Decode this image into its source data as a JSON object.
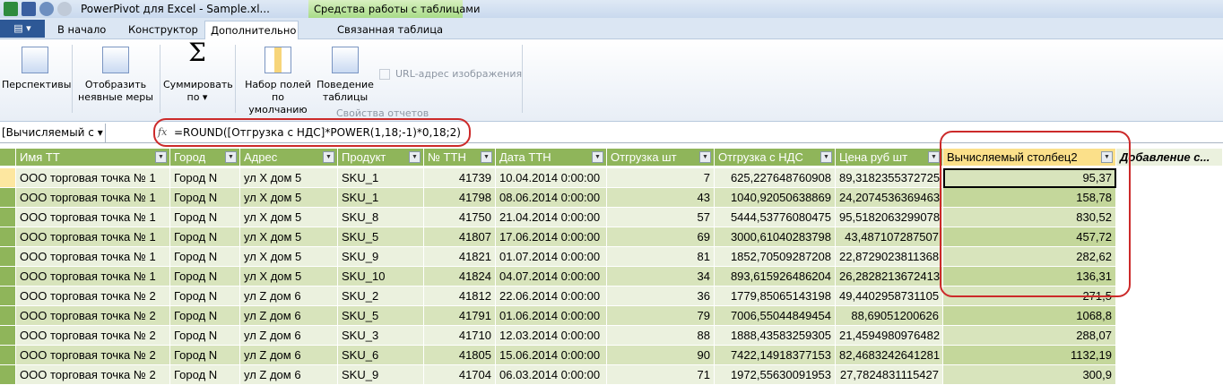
{
  "window": {
    "title": "PowerPivot для Excel - Sample.xl...",
    "context_tab": "Средства работы с таблицами"
  },
  "tabs": [
    "В начало",
    "Конструктор",
    "Дополнительно",
    "Связанная таблица"
  ],
  "ribbon": {
    "perspectives": "Перспективы",
    "show_implicit_1": "Отобразить",
    "show_implicit_2": "неявные меры",
    "summarize_1": "Суммировать",
    "summarize_2": "по ▾",
    "default_fields_1": "Набор полей",
    "default_fields_2": "по умолчанию",
    "table_behavior_1": "Поведение",
    "table_behavior_2": "таблицы",
    "image_url": "URL-адрес изображения",
    "group_label": "Свойства отчетов"
  },
  "formula_bar": {
    "name_box": "[Вычисляемый с",
    "formula": "=ROUND([Отгрузка с НДС]*POWER(1,18;-1)*0,18;2)"
  },
  "colors": {
    "header_green": "#8fb55a",
    "highlight_red": "#cc2a2a",
    "calc_header": "#fbe08a"
  },
  "table": {
    "columns": [
      "Имя ТТ",
      "Город",
      "Адрес",
      "Продукт",
      "№ ТТН",
      "Дата ТТН",
      "Отгрузка  шт",
      "Отгрузка с НДС",
      "Цена руб шт",
      "Вычисляемый столбец2",
      "Добавление с..."
    ],
    "rows": [
      [
        "ООО торговая точка № 1",
        "Город N",
        "ул X дом 5",
        "SKU_1",
        "41739",
        "10.04.2014 0:00:00",
        "7",
        "625,227648760908",
        "89,3182355372725",
        "95,37"
      ],
      [
        "ООО торговая точка № 1",
        "Город N",
        "ул X дом 5",
        "SKU_1",
        "41798",
        "08.06.2014 0:00:00",
        "43",
        "1040,92050638869",
        "24,2074536369463",
        "158,78"
      ],
      [
        "ООО торговая точка № 1",
        "Город N",
        "ул X дом 5",
        "SKU_8",
        "41750",
        "21.04.2014 0:00:00",
        "57",
        "5444,53776080475",
        "95,5182063299078",
        "830,52"
      ],
      [
        "ООО торговая точка № 1",
        "Город N",
        "ул X дом 5",
        "SKU_5",
        "41807",
        "17.06.2014 0:00:00",
        "69",
        "3000,61040283798",
        "43,487107287507",
        "457,72"
      ],
      [
        "ООО торговая точка № 1",
        "Город N",
        "ул X дом 5",
        "SKU_9",
        "41821",
        "01.07.2014 0:00:00",
        "81",
        "1852,70509287208",
        "22,8729023811368",
        "282,62"
      ],
      [
        "ООО торговая точка № 1",
        "Город N",
        "ул X дом 5",
        "SKU_10",
        "41824",
        "04.07.2014 0:00:00",
        "34",
        "893,615926486204",
        "26,2828213672413",
        "136,31"
      ],
      [
        "ООО торговая точка № 2",
        "Город N",
        "ул Z дом 6",
        "SKU_2",
        "41812",
        "22.06.2014 0:00:00",
        "36",
        "1779,85065143198",
        "49,4402958731105",
        "271,5"
      ],
      [
        "ООО торговая точка № 2",
        "Город N",
        "ул Z дом 6",
        "SKU_5",
        "41791",
        "01.06.2014 0:00:00",
        "79",
        "7006,55044849454",
        "88,69051200626",
        "1068,8"
      ],
      [
        "ООО торговая точка № 2",
        "Город N",
        "ул Z дом 6",
        "SKU_3",
        "41710",
        "12.03.2014 0:00:00",
        "88",
        "1888,43583259305",
        "21,4594980976482",
        "288,07"
      ],
      [
        "ООО торговая точка № 2",
        "Город N",
        "ул Z дом 6",
        "SKU_6",
        "41805",
        "15.06.2014 0:00:00",
        "90",
        "7422,14918377153",
        "82,4683242641281",
        "1132,19"
      ],
      [
        "ООО торговая точка № 2",
        "Город N",
        "ул Z дом 6",
        "SKU_9",
        "41704",
        "06.03.2014 0:00:00",
        "71",
        "1972,55630091953",
        "27,7824831115427",
        "300,9"
      ]
    ]
  }
}
